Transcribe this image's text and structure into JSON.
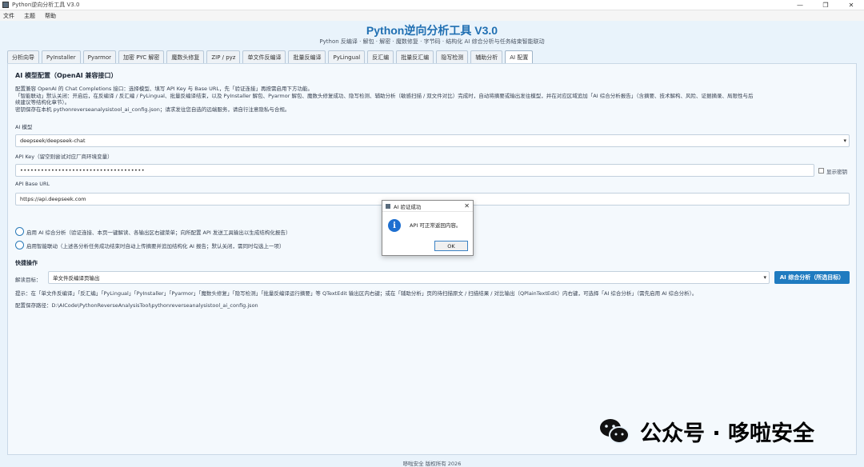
{
  "window": {
    "title": "Python逆向分析工具 V3.0"
  },
  "menu": [
    "文件",
    "主题",
    "帮助"
  ],
  "header": {
    "title": "Python逆向分析工具 V3.0",
    "subtitle": "Python 反编译 · 解包 · 解密 · 魔数修复 · 字节码 · 结构化 AI 综合分析与任务结束智能联动"
  },
  "tabs": [
    {
      "label": "分析向导",
      "active": false
    },
    {
      "label": "PyInstaller",
      "active": false
    },
    {
      "label": "Pyarmor",
      "active": false
    },
    {
      "label": "加密 PYC 解密",
      "active": false
    },
    {
      "label": "魔数头修复",
      "active": false
    },
    {
      "label": "ZIP / pyz",
      "active": false
    },
    {
      "label": "单文件反编译",
      "active": false
    },
    {
      "label": "批量反编译",
      "active": false
    },
    {
      "label": "PyLingual",
      "active": false
    },
    {
      "label": "反汇编",
      "active": false
    },
    {
      "label": "批量反汇编",
      "active": false
    },
    {
      "label": "隐写检测",
      "active": false
    },
    {
      "label": "辅助分析",
      "active": false
    },
    {
      "label": "AI 配置",
      "active": true
    }
  ],
  "ai_config": {
    "section_title": "AI 模型配置（OpenAI 兼容接口）",
    "desc_line1": "配置兼容 OpenAI 的 Chat Completions 接口：选择模型、填写 API Key 与 Base URL，先「验证连接」再按需启用下方功能。",
    "desc_line2": "「智能联动」默认关闭：开启后，在反编译 / 反汇编 / PyLingual、批量反编译结束，以及 PyInstaller 解包、Pyarmor 解包、魔数头修复成功、隐写检测、辅助分析（敏感扫描 / 双文件对比）完成时，自动将摘要或输出发往模型，并在对应区域追加「AI 综合分析报告」（含摘要、技术解构、风险、证据摘录、局限性与后",
    "desc_line3": "续建议等结构化章节）。",
    "desc_line4": "密钥保存在本机 pythonreverseanalysistool_ai_config.json；请求发往您自选的远端服务，请自行注意隐私与合规。",
    "model_label": "AI 模型",
    "model_value": "deepseek/deepseek-chat",
    "apikey_label": "API Key（留空则尝试对应厂商环境变量）",
    "apikey_value": "••••••••••••••••••••••••••••••••••••",
    "show_key_label": "显示密钥",
    "baseurl_label": "API Base URL",
    "baseurl_value": "https://api.deepseek.com",
    "enable_ai_label": "启用 AI 综合分析（验证连接、本页一键解读、各输出区右键菜单；向所配置 API 发送工具输出以生成结构化报告）",
    "enable_link_label": "启用智能联动（上述各分析任务成功结束时自动上传摘要并追加结构化 AI 报告；默认关闭，需同时勾选上一项）"
  },
  "quick": {
    "section_title": "快捷操作",
    "target_label": "解读目标：",
    "target_value": "单文件反编译页输出",
    "analyze_button": "AI 综合分析（所选目标）",
    "tip": "提示：在「单文件反编译」「反汇编」「PyLingual」「PyInstaller」「Pyarmor」「魔数头修复」「隐写检测」「批量反编译运行摘要」等 QTextEdit 输出区内右键；或在「辅助分析」页的待扫描原文 / 扫描结果 / 对比输出（QPlainTextEdit）内右键，可选择「AI 综合分析」（需先启用 AI 综合分析）。",
    "config_path": "配置保存路径：D:\\AICode\\PythonReverseAnalysisTool\\pythonreverseanalysistool_ai_config.json"
  },
  "dialog": {
    "title": "AI 验证成功",
    "message": "API 可正常返回内容。",
    "ok_label": "OK"
  },
  "footer": "哆啦安全 版权所有 2026",
  "watermark": {
    "text": "公众号 · 哆啦安全"
  },
  "colors": {
    "accent": "#1f7bc0",
    "title_blue": "#1f6fb2",
    "background": "#e9f3fb"
  }
}
